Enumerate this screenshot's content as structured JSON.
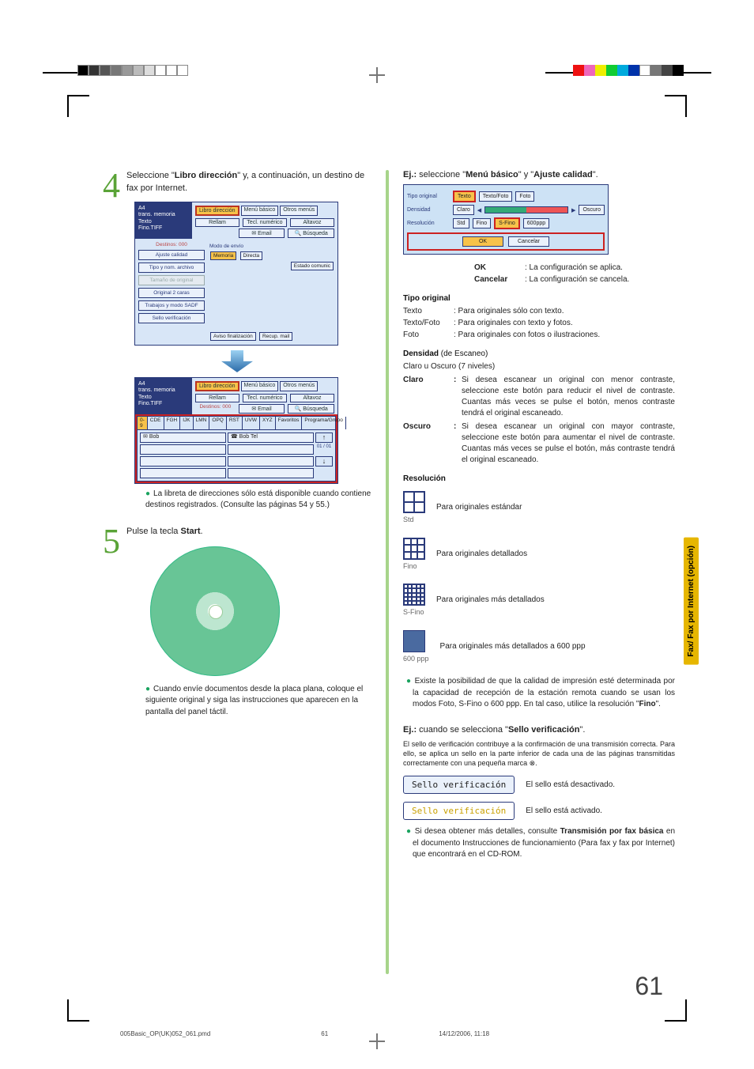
{
  "page_number": "61",
  "footer": {
    "file": "005Basic_OP(UK)052_061.pmd",
    "pg": "61",
    "date": "14/12/2006, 11:18"
  },
  "side_tab": "Fax/\nFax por Internet\n(opción)",
  "step4": {
    "num": "4",
    "text_a": "Seleccione \"",
    "text_b": "Libro dirección",
    "text_c": "\" y, a continuación, un destino de fax por Internet.",
    "note": "La libreta de direcciones sólo está disponible cuando contiene destinos registrados. (Consulte las páginas 54 y 55.)"
  },
  "panel_top": {
    "head": "A4\ntrans. memoria\nTexto\nFino.TIFF",
    "tabs": [
      "Libro dirección",
      "Menú básico",
      "Otros menús"
    ],
    "row2": [
      "Rellam",
      "Tecl. numérico",
      "Altavoz"
    ],
    "dest": "Destinos: 000",
    "email": "Email",
    "busq": "Búsqueda",
    "modo": "Modo de envío",
    "side": [
      "Ajuste calidad",
      "Tipo y nom. archivo",
      "Tamaño de original",
      "Original 2 caras",
      "Trabajos y modo SADF",
      "Sello verificación"
    ],
    "mem": "Memoria",
    "dir": "Directa",
    "est": "Estado comunic",
    "aviso": "Aviso finalización",
    "recup": "Recup. mail"
  },
  "panel_ab": {
    "tabs": [
      "0-9",
      "CDE",
      "FGH",
      "IJK",
      "LMN",
      "OPQ",
      "RST",
      "UVW",
      "XYZ",
      "Favoritos",
      "Programa/Grupo"
    ],
    "bob": "Bob",
    "bobtel": "Bob Tel",
    "counter": "01 / 01"
  },
  "step5": {
    "num": "5",
    "text_a": "Pulse la tecla ",
    "text_b": "Start",
    "text_c": ".",
    "note": "Cuando envíe documentos desde la placa plana, coloque el siguiente original y siga las instrucciones que aparecen en la pantalla del panel táctil."
  },
  "right": {
    "ej1_a": "Ej.: ",
    "ej1_b": "seleccione \"",
    "ej1_c": "Menú básico",
    "ej1_d": "\" y \"",
    "ej1_e": "Ajuste calidad",
    "ej1_f": "\".",
    "qp": {
      "tipo": "Tipo original",
      "texto": "Texto",
      "tf": "Texto/Foto",
      "foto": "Foto",
      "dens": "Densidad",
      "claro": "Claro",
      "oscuro": "Oscuro",
      "reso": "Resolución",
      "std": "Std",
      "fino": "Fino",
      "sfino": "S-Fino",
      "ppp": "600ppp",
      "ok": "OK",
      "cancel": "Cancelar"
    },
    "okline": {
      "ok": "OK",
      "okdesc": ": La configuración se aplica.",
      "cancel": "Cancelar",
      "canceldesc": ": La configuración se cancela."
    },
    "tipo": {
      "h": "Tipo original",
      "texto_k": "Texto",
      "texto_v": ": Para originales sólo con texto.",
      "tf_k": "Texto/Foto",
      "tf_v": ": Para originales con texto y fotos.",
      "foto_k": "Foto",
      "foto_v": ": Para originales con fotos o ilustraciones."
    },
    "dens": {
      "h": "Densidad",
      "sub": " (de Escaneo)",
      "line": "Claro u Oscuro (7 niveles)",
      "claro_k": "Claro",
      "claro_v": "Si desea escanear un original con menor contraste, seleccione este botón para reducir el nivel de contraste. Cuantas más veces se pulse el botón, menos contraste tendrá el original escaneado.",
      "oscuro_k": "Oscuro",
      "oscuro_v": "Si desea escanear un original con mayor contraste, seleccione este botón para aumentar el nivel de contraste. Cuantas más veces se pulse el botón, más contraste tendrá el original escaneado."
    },
    "reso": {
      "h": "Resolución",
      "std_l": "Std",
      "std_v": "Para originales estándar",
      "fino_l": "Fino",
      "fino_v": "Para originales detallados",
      "sfino_l": "S-Fino",
      "sfino_v": "Para originales más detallados",
      "ppp_l": "600 ppp",
      "ppp_v": "Para originales más detallados a 600 ppp"
    },
    "resnote_a": "Existe la posibilidad de que la calidad de impresión esté determinada por la capacidad de recepción de la estación remota cuando se usan los modos Foto, S-Fino o 600 ppp. En tal caso, utilice la resolución \"",
    "resnote_b": "Fino",
    "resnote_c": "\".",
    "ej2_a": "Ej.: ",
    "ej2_b": "cuando se selecciona \"",
    "ej2_c": "Sello verificación",
    "ej2_d": "\".",
    "stamp_desc": "El sello de verificación contribuye a la confirmación de una transmisión correcta. Para ello, se aplica un sello en la parte inferior de cada una de las páginas transmitidas correctamente con una pequeña marca ⊗.",
    "stamp_btn": "Sello verificación",
    "stamp_off": "El sello está desactivado.",
    "stamp_on": "El sello está activado.",
    "stamp_note_a": "Si desea obtener más detalles, consulte ",
    "stamp_note_b": "Transmisión por fax básica",
    "stamp_note_c": " en el documento Instrucciones de funcionamiento (Para fax y fax por Internet) que encontrará en el CD-ROM."
  }
}
